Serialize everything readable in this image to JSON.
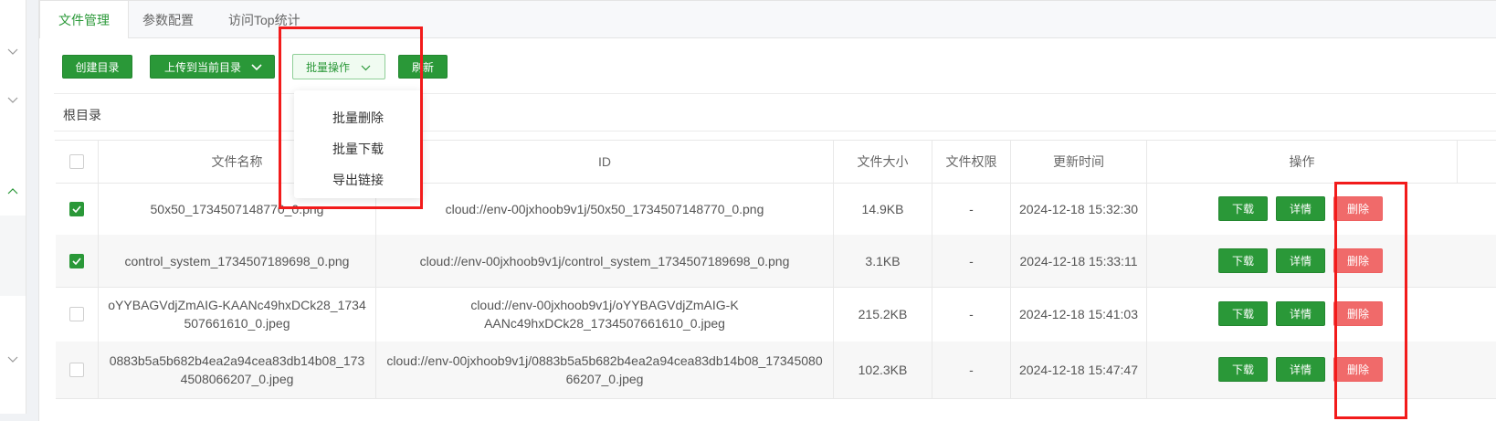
{
  "tabs": [
    {
      "label": "文件管理",
      "active": true
    },
    {
      "label": "参数配置",
      "active": false
    },
    {
      "label": "访问Top统计",
      "active": false
    }
  ],
  "toolbar": {
    "create_dir": "创建目录",
    "upload": "上传到当前目录",
    "batch": "批量操作",
    "refresh": "刷新"
  },
  "batch_menu": [
    "批量删除",
    "批量下载",
    "导出链接"
  ],
  "breadcrumb": "根目录",
  "table": {
    "headers": [
      "文件名称",
      "ID",
      "文件大小",
      "文件权限",
      "更新时间",
      "操作"
    ],
    "rows": [
      {
        "checked": true,
        "name": "50x50_1734507148770_0.png",
        "id": "cloud://env-00jxhoob9v1j/50x50_1734507148770_0.png",
        "size": "14.9KB",
        "perm": "-",
        "time": "2024-12-18 15:32:30"
      },
      {
        "checked": true,
        "name": "control_system_1734507189698_0.png",
        "id": "cloud://env-00jxhoob9v1j/control_system_1734507189698_0.png",
        "size": "3.1KB",
        "perm": "-",
        "time": "2024-12-18 15:33:11"
      },
      {
        "checked": false,
        "name": "oYYBAGVdjZmAIG-KAANc49hxDCk28_1734507661610_0.jpeg",
        "id": "cloud://env-00jxhoob9v1j/oYYBAGVdjZmAIG-KAANc49hxDCk28_1734507661610_0.jpeg",
        "size": "215.2KB",
        "perm": "-",
        "time": "2024-12-18 15:41:03"
      },
      {
        "checked": false,
        "name": "0883b5a5b682b4ea2a94cea83db14b08_1734508066207_0.jpeg",
        "id": "cloud://env-00jxhoob9v1j/0883b5a5b682b4ea2a94cea83db14b08_1734508066207_0.jpeg",
        "size": "102.3KB",
        "perm": "-",
        "time": "2024-12-18 15:47:47"
      }
    ],
    "actions": {
      "download": "下载",
      "detail": "详情",
      "delete": "删除"
    }
  },
  "colors": {
    "primary": "#2a9838",
    "danger": "#f06a6a",
    "highlight": "#f21b1b"
  }
}
